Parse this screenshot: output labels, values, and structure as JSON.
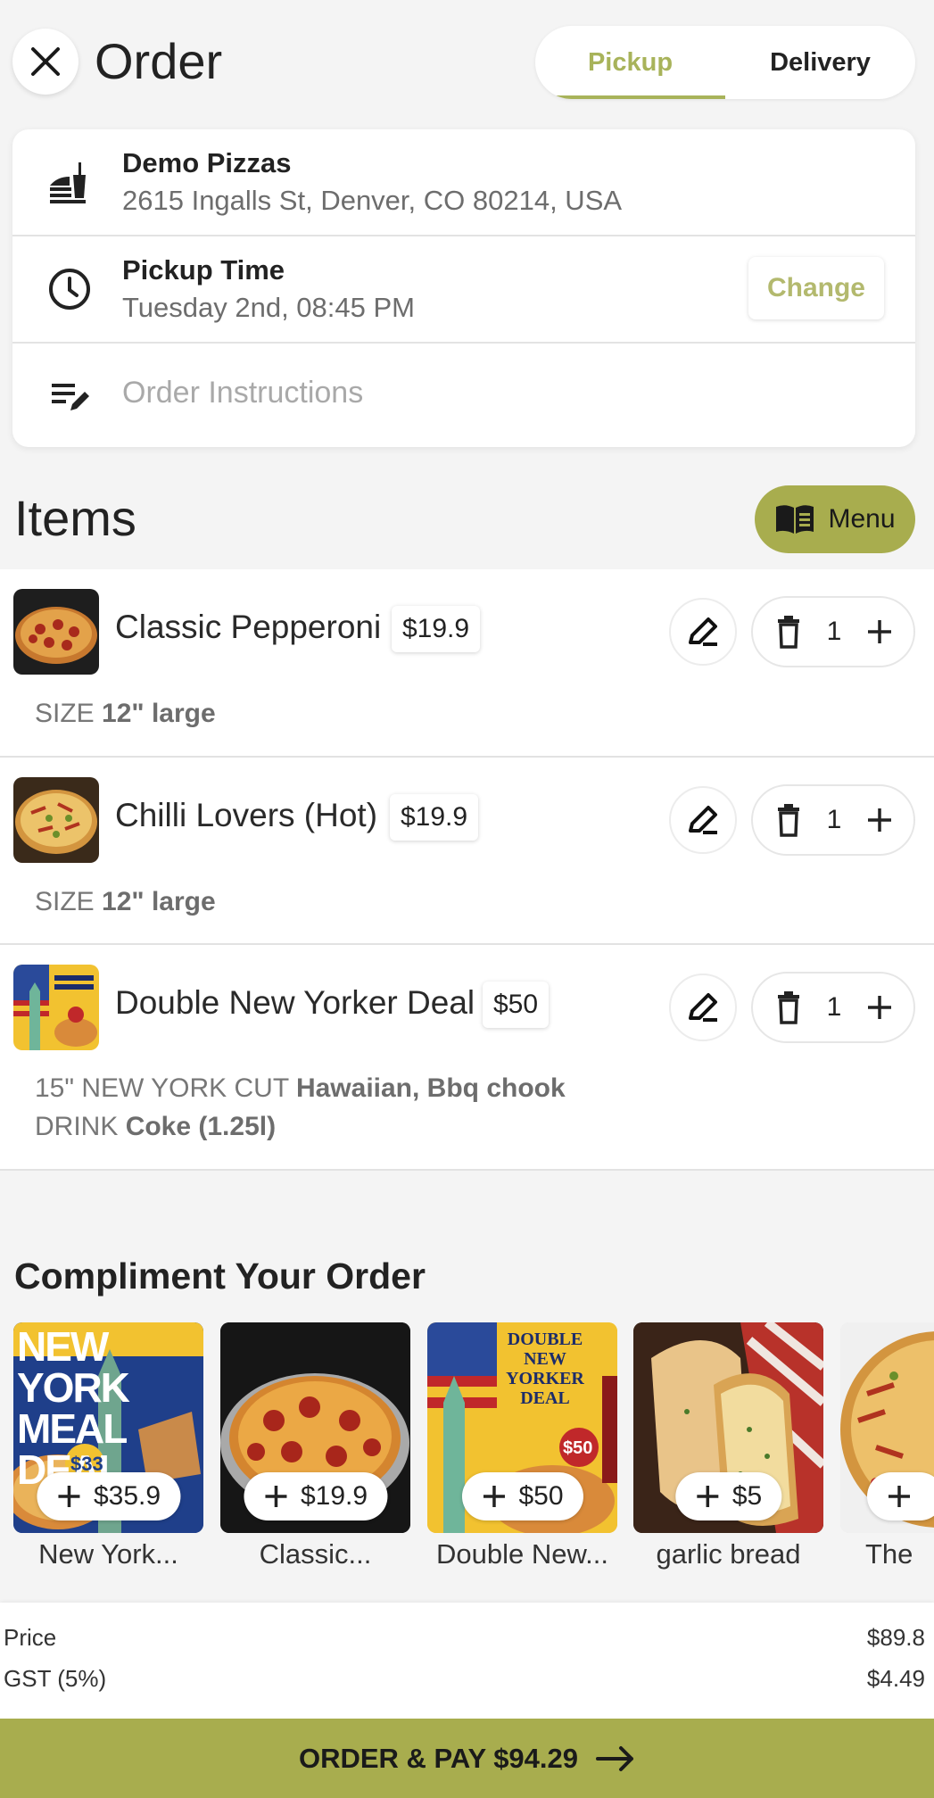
{
  "header": {
    "title": "Order",
    "tabs": [
      {
        "label": "Pickup",
        "active": true
      },
      {
        "label": "Delivery",
        "active": false
      }
    ]
  },
  "store": {
    "name": "Demo Pizzas",
    "address": "2615 Ingalls St, Denver, CO 80214, USA"
  },
  "pickup": {
    "title": "Pickup Time",
    "value": "Tuesday 2nd, 08:45 PM",
    "change_label": "Change"
  },
  "instructions": {
    "placeholder": "Order Instructions"
  },
  "items_section": {
    "heading": "Items",
    "menu_label": "Menu"
  },
  "items": [
    {
      "name": "Classic Pepperoni",
      "price": "$19.9",
      "qty": "1",
      "options": [
        {
          "label": "SIZE",
          "value": "12\" large"
        }
      ]
    },
    {
      "name": "Chilli Lovers (Hot)",
      "price": "$19.9",
      "qty": "1",
      "options": [
        {
          "label": "SIZE",
          "value": "12\" large"
        }
      ]
    },
    {
      "name": "Double New Yorker Deal",
      "price": "$50",
      "qty": "1",
      "options": [
        {
          "label": "15\" NEW YORK CUT",
          "value": "Hawaiian, Bbq chook"
        },
        {
          "label": "DRINK",
          "value": "Coke (1.25l)"
        }
      ]
    }
  ],
  "compliment": {
    "heading": "Compliment Your Order",
    "cards": [
      {
        "price": "$35.9",
        "label": "New York..."
      },
      {
        "price": "$19.9",
        "label": "Classic..."
      },
      {
        "price": "$50",
        "label": "Double New..."
      },
      {
        "price": "$5",
        "label": "garlic bread"
      },
      {
        "price": "",
        "label": "The"
      }
    ],
    "promo_text": {
      "ny_meal_deal": "NEW YORK MEAL DEAL",
      "ny_price": "$33",
      "double_deal": "DOUBLE NEW YORKER DEAL",
      "double_price": "$50"
    }
  },
  "totals": {
    "price_label": "Price",
    "price_value": "$89.8",
    "gst_label": "GST (5%)",
    "gst_value": "$4.49"
  },
  "pay_button": {
    "label": "ORDER & PAY $94.29"
  },
  "colors": {
    "accent": "#a8ad4e",
    "accent_text": "#a8b35a",
    "background": "#f4f4f4"
  },
  "icons": [
    "close-icon",
    "restaurant-icon",
    "clock-icon",
    "edit-notes-icon",
    "menu-book-icon",
    "pencil-icon",
    "trash-icon",
    "plus-icon",
    "arrow-right-icon"
  ]
}
